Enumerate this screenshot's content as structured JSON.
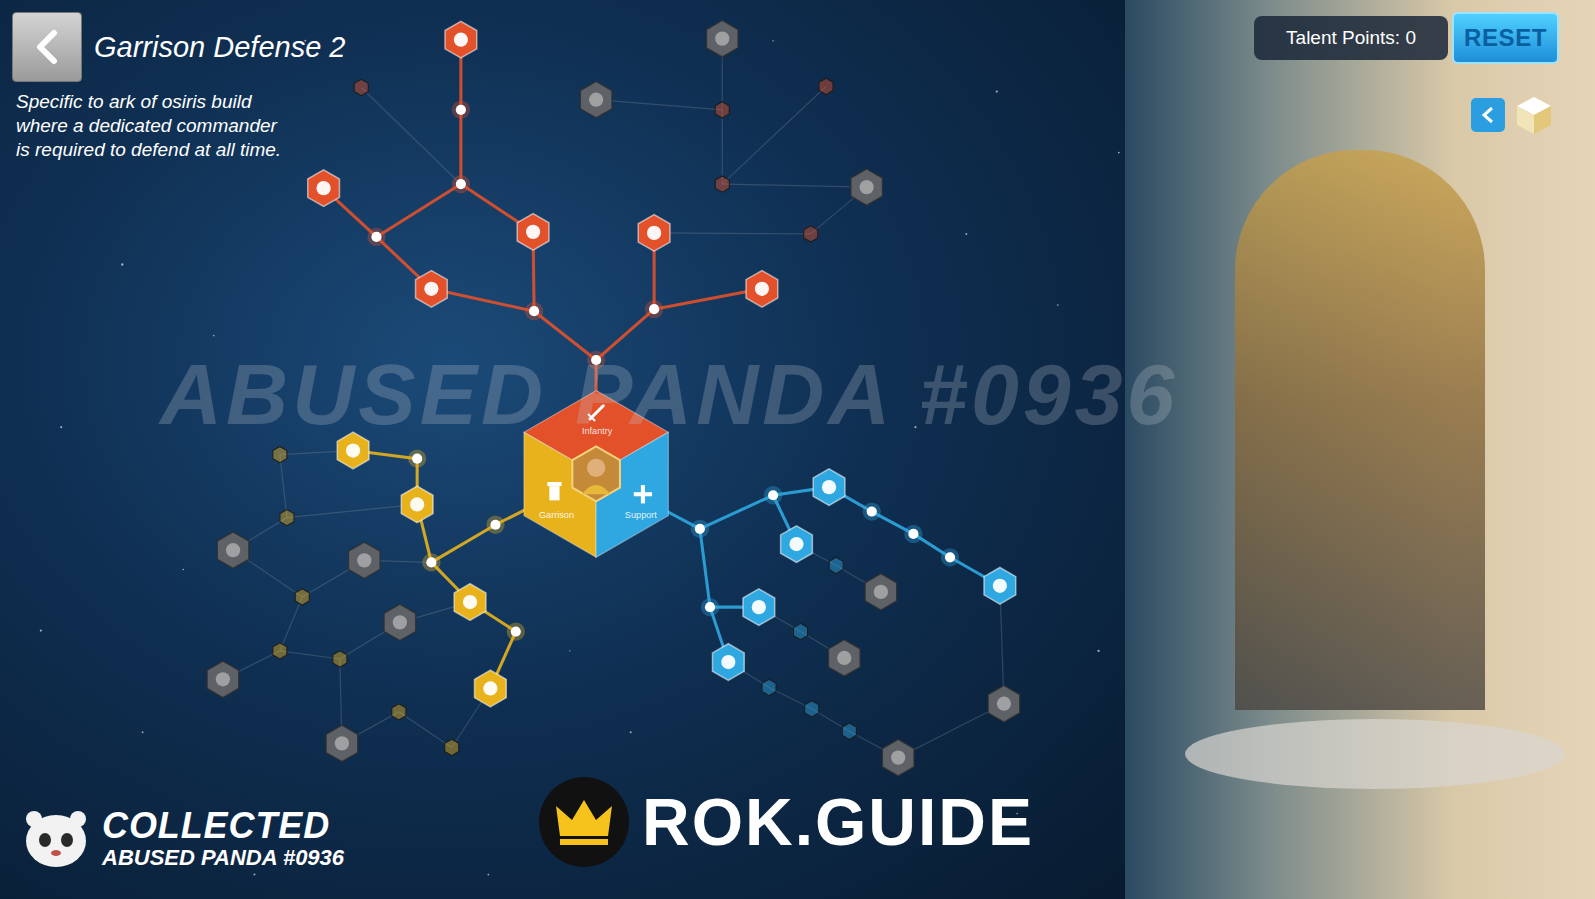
{
  "header": {
    "title": "Garrison Defense 2",
    "description": [
      "Specific to ark of osiris build",
      "where a dedicated commander",
      "is required to defend at all time."
    ]
  },
  "talent_points": "Talent Points: 0",
  "reset_button": "RESET",
  "branches": [
    {
      "name": "Infantry",
      "color": "#e2512a"
    },
    {
      "name": "Garrison",
      "color": "#e8b21c"
    },
    {
      "name": "Support",
      "color": "#2fa7e0"
    }
  ],
  "nodes": [
    {
      "branch": "Infantry",
      "active": true,
      "kind": "small"
    },
    {
      "branch": "Infantry",
      "active": true,
      "kind": "small"
    },
    {
      "branch": "Infantry",
      "active": true,
      "kind": "small"
    },
    {
      "branch": "Infantry",
      "active": true,
      "kind": "big"
    },
    {
      "branch": "Infantry",
      "active": true,
      "kind": "small"
    },
    {
      "branch": "Infantry",
      "active": true,
      "kind": "big"
    },
    {
      "branch": "Infantry",
      "active": true,
      "kind": "small"
    },
    {
      "branch": "Infantry",
      "active": true,
      "kind": "big"
    },
    {
      "branch": "Infantry",
      "active": true,
      "kind": "small"
    },
    {
      "branch": "Infantry",
      "active": true,
      "kind": "big"
    },
    {
      "branch": "Infantry",
      "active": true,
      "kind": "big"
    },
    {
      "branch": "Infantry",
      "active": true,
      "kind": "big"
    },
    {
      "branch": "Infantry",
      "active": false,
      "kind": "small"
    },
    {
      "branch": "Infantry",
      "active": false,
      "kind": "big"
    },
    {
      "branch": "Infantry",
      "active": false,
      "kind": "big"
    },
    {
      "branch": "Infantry",
      "active": false,
      "kind": "small"
    },
    {
      "branch": "Infantry",
      "active": false,
      "kind": "small"
    },
    {
      "branch": "Infantry",
      "active": false,
      "kind": "small"
    },
    {
      "branch": "Infantry",
      "active": false,
      "kind": "big"
    },
    {
      "branch": "Infantry",
      "active": false,
      "kind": "small"
    },
    {
      "branch": "Garrison",
      "active": true,
      "kind": "small"
    },
    {
      "branch": "Garrison",
      "active": true,
      "kind": "small"
    },
    {
      "branch": "Garrison",
      "active": true,
      "kind": "big"
    },
    {
      "branch": "Garrison",
      "active": true,
      "kind": "small"
    },
    {
      "branch": "Garrison",
      "active": true,
      "kind": "big"
    },
    {
      "branch": "Garrison",
      "active": true,
      "kind": "big"
    },
    {
      "branch": "Garrison",
      "active": true,
      "kind": "small"
    },
    {
      "branch": "Garrison",
      "active": true,
      "kind": "big"
    },
    {
      "branch": "Garrison",
      "active": false,
      "kind": "small"
    },
    {
      "branch": "Garrison",
      "active": false,
      "kind": "big"
    },
    {
      "branch": "Garrison",
      "active": false,
      "kind": "big"
    },
    {
      "branch": "Garrison",
      "active": false,
      "kind": "small"
    },
    {
      "branch": "Garrison",
      "active": false,
      "kind": "small"
    },
    {
      "branch": "Garrison",
      "active": false,
      "kind": "big"
    },
    {
      "branch": "Garrison",
      "active": false,
      "kind": "small"
    },
    {
      "branch": "Garrison",
      "active": false,
      "kind": "small"
    },
    {
      "branch": "Garrison",
      "active": false,
      "kind": "big"
    },
    {
      "branch": "Garrison",
      "active": false,
      "kind": "small"
    },
    {
      "branch": "Garrison",
      "active": false,
      "kind": "big"
    },
    {
      "branch": "Garrison",
      "active": false,
      "kind": "small"
    },
    {
      "branch": "Support",
      "active": true,
      "kind": "small"
    },
    {
      "branch": "Support",
      "active": true,
      "kind": "small"
    },
    {
      "branch": "Support",
      "active": true,
      "kind": "big"
    },
    {
      "branch": "Support",
      "active": true,
      "kind": "big"
    },
    {
      "branch": "Support",
      "active": true,
      "kind": "small"
    },
    {
      "branch": "Support",
      "active": true,
      "kind": "small"
    },
    {
      "branch": "Support",
      "active": true,
      "kind": "small"
    },
    {
      "branch": "Support",
      "active": true,
      "kind": "big"
    },
    {
      "branch": "Support",
      "active": true,
      "kind": "small"
    },
    {
      "branch": "Support",
      "active": true,
      "kind": "big"
    },
    {
      "branch": "Support",
      "active": true,
      "kind": "big"
    },
    {
      "branch": "Support",
      "active": false,
      "kind": "small"
    },
    {
      "branch": "Support",
      "active": false,
      "kind": "big"
    },
    {
      "branch": "Support",
      "active": false,
      "kind": "small"
    },
    {
      "branch": "Support",
      "active": false,
      "kind": "big"
    },
    {
      "branch": "Support",
      "active": false,
      "kind": "small"
    },
    {
      "branch": "Support",
      "active": false,
      "kind": "small"
    },
    {
      "branch": "Support",
      "active": false,
      "kind": "small"
    },
    {
      "branch": "Support",
      "active": false,
      "kind": "big"
    },
    {
      "branch": "Support",
      "active": false,
      "kind": "big"
    }
  ],
  "watermark": "ABUSED PANDA #0936",
  "collector": {
    "label": "COLLECTED",
    "name": "ABUSED PANDA #0936"
  },
  "brand": "ROK.GUIDE"
}
